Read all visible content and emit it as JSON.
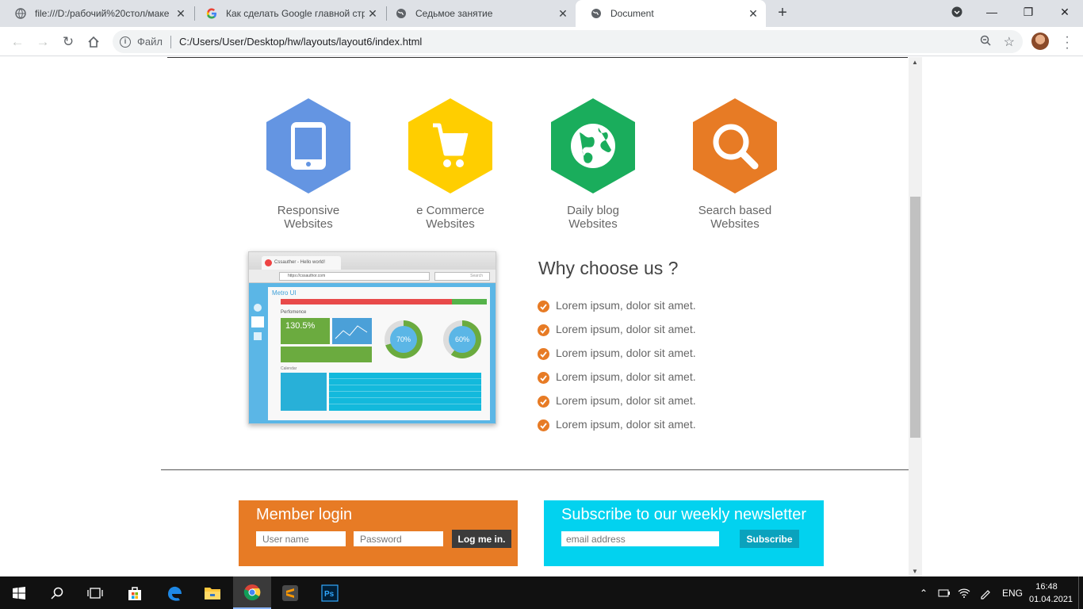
{
  "browser": {
    "tabs": [
      {
        "title": "file:///D:/рабочий%20стол/маке",
        "favicon": "globe-icon"
      },
      {
        "title": "Как сделать Google главной стр",
        "favicon": "google-icon"
      },
      {
        "title": "Седьмое занятие",
        "favicon": "globe-icon"
      },
      {
        "title": "Document",
        "favicon": "globe-icon"
      }
    ],
    "scheme_label": "Файл",
    "url": "C:/Users/User/Desktop/hw/layouts/layout6/index.html"
  },
  "features": [
    {
      "line1": "Responsive",
      "line2": "Websites",
      "color": "#6495e2",
      "icon": "tablet-icon"
    },
    {
      "line1": "e Commerce",
      "line2": "Websites",
      "color": "#ffce00",
      "icon": "cart-icon"
    },
    {
      "line1": "Daily blog",
      "line2": "Websites",
      "color": "#1aad5c",
      "icon": "globe-icon"
    },
    {
      "line1": "Search based",
      "line2": "Websites",
      "color": "#e77b25",
      "icon": "search-icon"
    }
  ],
  "mockup": {
    "tab_title": "Cssauther - Hello world!",
    "url": "https://cssauthor.com",
    "search": "Search",
    "app_title": "Metro UI",
    "section": "Perfomence",
    "stat": "130.5%",
    "ring1": "70%",
    "ring2": "60%",
    "calendar_label": "Calendar"
  },
  "why": {
    "title": "Why choose us ?",
    "items": [
      "Lorem ipsum, dolor sit amet.",
      "Lorem ipsum, dolor sit amet.",
      "Lorem ipsum, dolor sit amet.",
      "Lorem ipsum, dolor sit amet.",
      "Lorem ipsum, dolor sit amet.",
      "Lorem ipsum, dolor sit amet."
    ]
  },
  "login": {
    "title": "Member login",
    "user_placeholder": "User name",
    "pass_placeholder": "Password",
    "button": "Log me in."
  },
  "newsletter": {
    "title": "Subscribe to our weekly newsletter",
    "email_placeholder": "email address",
    "button": "Subscribe"
  },
  "taskbar": {
    "lang": "ENG",
    "time": "16:48",
    "date": "01.04.2021"
  },
  "colors": {
    "orange": "#e77b25",
    "cyan": "#02d2ef",
    "dark_button": "#3b3b3b"
  }
}
